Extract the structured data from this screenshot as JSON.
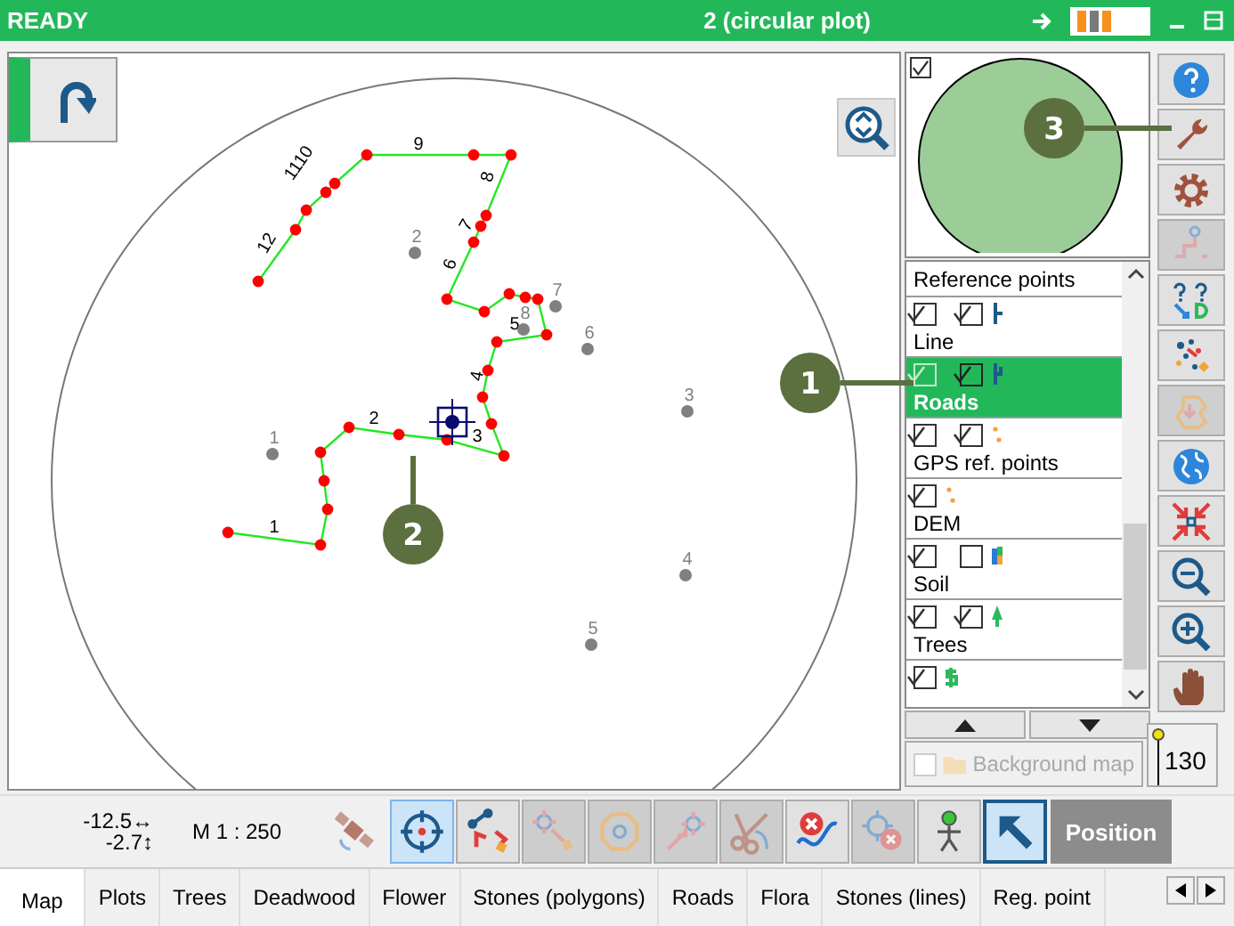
{
  "window": {
    "status": "READY",
    "title": "2 (circular plot)"
  },
  "map": {
    "segment_labels": [
      "1",
      "2",
      "3",
      "4",
      "5",
      "6",
      "7",
      "8",
      "9",
      "1110",
      "12"
    ],
    "reference_points": [
      "1",
      "2",
      "3",
      "4",
      "5",
      "6",
      "7",
      "8"
    ]
  },
  "callouts": [
    "1",
    "2",
    "3"
  ],
  "minimap": {
    "checked": true
  },
  "layers": {
    "header": "Reference points",
    "items": [
      {
        "name": "Line",
        "kind": "line",
        "selected": false,
        "checks": [
          {
            "checked": true,
            "disabled": false
          },
          {
            "checked": true,
            "disabled": false
          }
        ]
      },
      {
        "name": "Roads",
        "kind": "road",
        "selected": true,
        "checks": [
          {
            "checked": true,
            "disabled": true
          },
          {
            "checked": true,
            "disabled": false
          }
        ]
      },
      {
        "name": "GPS ref. points",
        "kind": "gps",
        "selected": false,
        "checks": [
          {
            "checked": true,
            "disabled": false
          },
          {
            "checked": true,
            "disabled": false
          }
        ]
      },
      {
        "name": "DEM",
        "kind": "dem",
        "selected": false,
        "checks": [
          {
            "checked": true,
            "disabled": false
          }
        ]
      },
      {
        "name": "Soil",
        "kind": "soil",
        "selected": false,
        "checks": [
          {
            "checked": true,
            "disabled": false
          },
          {
            "checked": false,
            "disabled": false
          }
        ]
      },
      {
        "name": "Trees",
        "kind": "trees",
        "selected": false,
        "checks": [
          {
            "checked": true,
            "disabled": false
          },
          {
            "checked": true,
            "disabled": false
          }
        ]
      },
      {
        "kind": "money",
        "selected": false,
        "checks": [
          {
            "checked": true,
            "disabled": false
          }
        ]
      }
    ]
  },
  "background_map": {
    "label": "Background map",
    "checked": false,
    "disabled": true
  },
  "scale_slider": {
    "level": 1,
    "reading": "130"
  },
  "side_tools": [
    {
      "kind": "help",
      "disabled": false
    },
    {
      "kind": "wrench",
      "disabled": false
    },
    {
      "kind": "gear",
      "disabled": false
    },
    {
      "kind": "route",
      "disabled": true
    },
    {
      "kind": "help-pair",
      "disabled": false
    },
    {
      "kind": "scatter",
      "disabled": false
    },
    {
      "kind": "undo-shape",
      "disabled": true
    },
    {
      "kind": "globe",
      "disabled": false
    },
    {
      "kind": "collapse",
      "disabled": false
    },
    {
      "kind": "zoom-out",
      "disabled": false
    },
    {
      "kind": "zoom-in",
      "disabled": false
    },
    {
      "kind": "hand",
      "disabled": false
    }
  ],
  "coordinates": [
    "-12.5↔",
    "-2.7↕"
  ],
  "scale": "M 1 : 250",
  "tools": [
    {
      "kind": "satellite",
      "selected": false,
      "disabled": true
    },
    {
      "kind": "target",
      "selected": true,
      "disabled": false
    },
    {
      "kind": "edit-line",
      "selected": false,
      "disabled": false
    },
    {
      "kind": "move-point",
      "selected": false,
      "disabled": true
    },
    {
      "kind": "shape-point",
      "selected": false,
      "disabled": true
    },
    {
      "kind": "add-point",
      "selected": false,
      "disabled": true
    },
    {
      "kind": "scissors",
      "selected": false,
      "disabled": true
    },
    {
      "kind": "delete-line",
      "selected": false,
      "disabled": false
    },
    {
      "kind": "delete-point",
      "selected": false,
      "disabled": true
    },
    {
      "kind": "person",
      "selected": false,
      "disabled": false
    },
    {
      "kind": "pointer",
      "selected": true,
      "disabled": false
    }
  ],
  "position_button": "Position",
  "tabs": [
    {
      "label": "Map",
      "selected": true
    },
    {
      "label": "Plots",
      "selected": false
    },
    {
      "label": "Trees",
      "selected": false
    },
    {
      "label": "Deadwood",
      "selected": false
    },
    {
      "label": "Flower",
      "selected": false
    },
    {
      "label": "Stones (polygons)",
      "selected": false
    },
    {
      "label": "Roads",
      "selected": false
    },
    {
      "label": "Flora",
      "selected": false
    },
    {
      "label": "Stones (lines)",
      "selected": false
    },
    {
      "label": "Reg. point",
      "selected": false
    }
  ]
}
